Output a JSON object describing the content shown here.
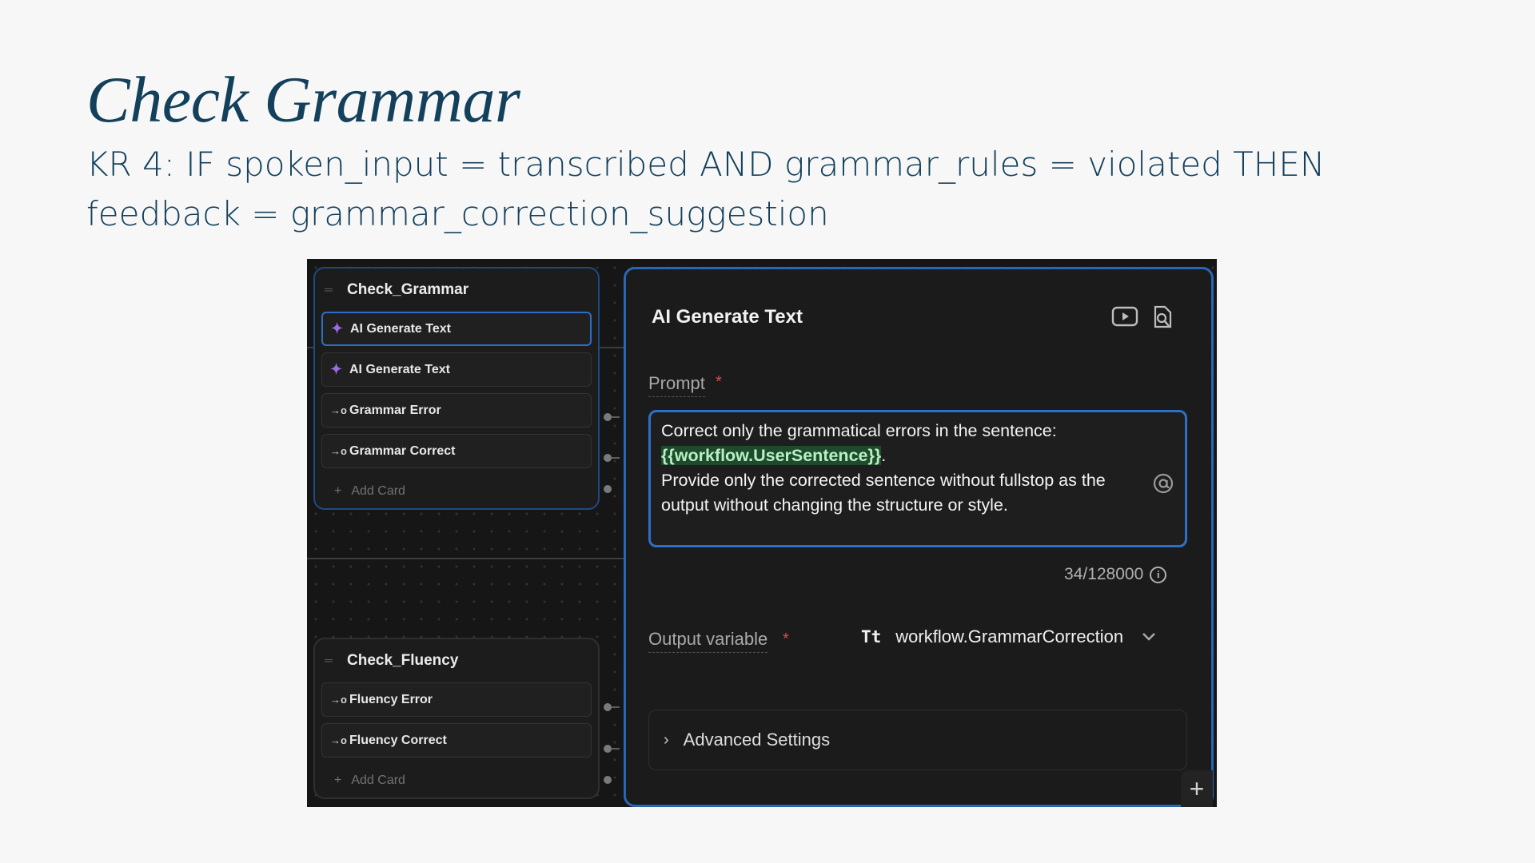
{
  "slide": {
    "title": "Check Grammar",
    "subtitle": "KR 4: IF spoken_input = transcribed AND grammar_rules = violated THEN feedback = grammar_correction_suggestion"
  },
  "canvas": {
    "group1": {
      "title": "Check_Grammar",
      "cards": [
        {
          "label": "AI Generate Text",
          "icon": "sparkle-icon"
        },
        {
          "label": "AI Generate Text",
          "icon": "sparkle-icon"
        },
        {
          "label": "Grammar Error",
          "icon": "arrow-circle-icon"
        },
        {
          "label": "Grammar Correct",
          "icon": "arrow-circle-icon"
        }
      ],
      "add_card": "Add Card"
    },
    "group2": {
      "title": "Check_Fluency",
      "cards": [
        {
          "label": "Fluency Error",
          "icon": "arrow-circle-icon"
        },
        {
          "label": "Fluency Correct",
          "icon": "arrow-circle-icon"
        }
      ],
      "add_card": "Add Card"
    }
  },
  "panel": {
    "title": "AI Generate Text",
    "prompt_label": "Prompt",
    "required_mark": "*",
    "prompt_line1": "Correct only the grammatical errors in the sentence:",
    "prompt_variable": "{{workflow.UserSentence}}",
    "prompt_after_variable": ".",
    "prompt_line3": "Provide only the corrected sentence without fullstop as the output without changing the structure or style.",
    "char_count": "34/128000",
    "output_label": "Output variable",
    "output_type_icon": "Tt",
    "output_value": "workflow.GrammarCorrection",
    "advanced_settings": "Advanced Settings"
  },
  "colors": {
    "title": "#13405b",
    "accent_blue": "#2e70c8",
    "sparkle": "#9c6be0",
    "required": "#e24a4a",
    "variable_highlight": "#1f4a2b"
  }
}
